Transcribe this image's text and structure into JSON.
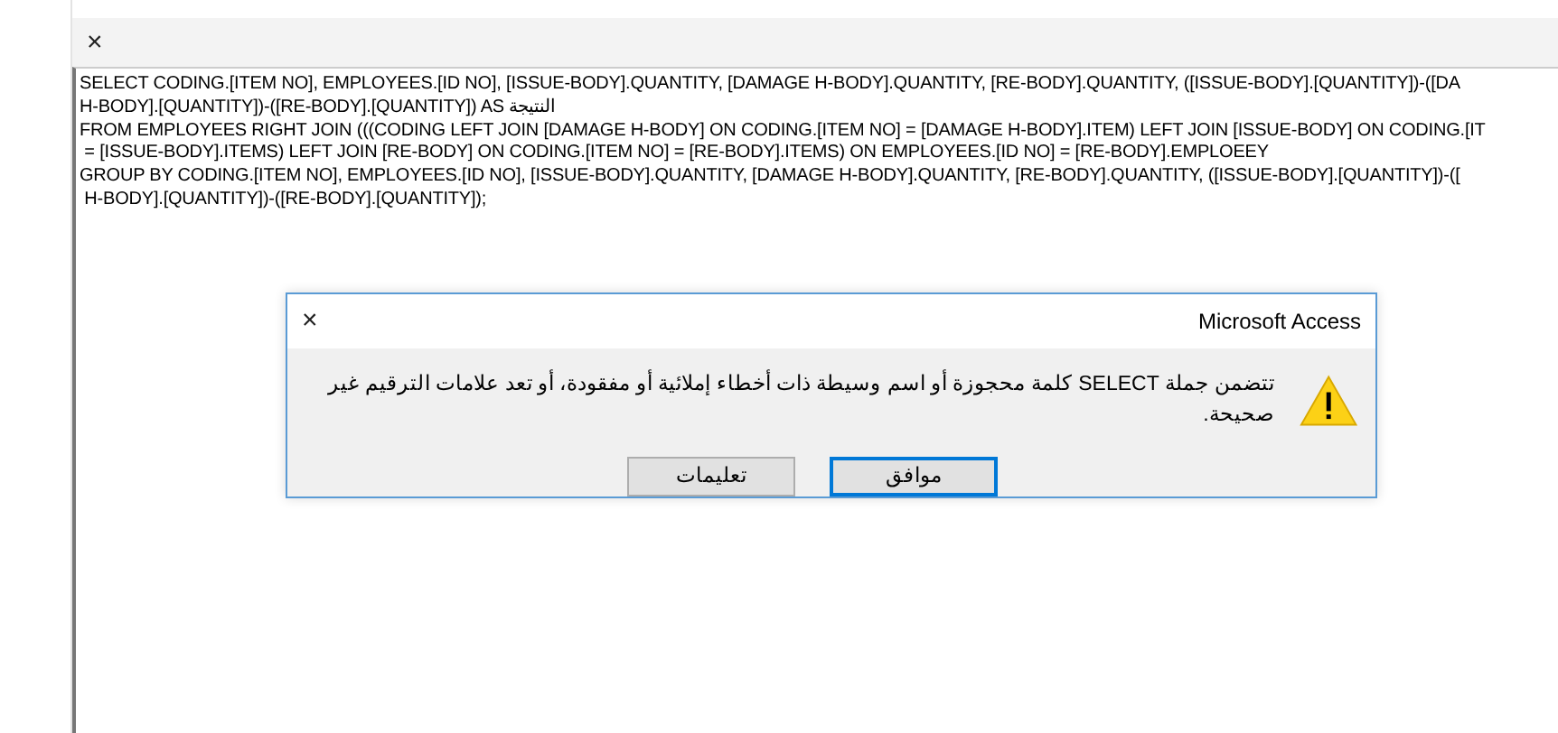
{
  "editor": {
    "close": "×",
    "sql_lines": [
      "SELECT CODING.[ITEM NO], EMPLOYEES.[ID NO], [ISSUE-BODY].QUANTITY, [DAMAGE H-BODY].QUANTITY, [RE-BODY].QUANTITY, ([ISSUE-BODY].[QUANTITY])-([DA",
      "H-BODY].[QUANTITY])-([RE-BODY].[QUANTITY]) AS النتيجة",
      "FROM EMPLOYEES RIGHT JOIN (((CODING LEFT JOIN [DAMAGE H-BODY] ON CODING.[ITEM NO] = [DAMAGE H-BODY].ITEM) LEFT JOIN [ISSUE-BODY] ON CODING.[IT",
      " = [ISSUE-BODY].ITEMS) LEFT JOIN [RE-BODY] ON CODING.[ITEM NO] = [RE-BODY].ITEMS) ON EMPLOYEES.[ID NO] = [RE-BODY].EMPLOEEY",
      "GROUP BY CODING.[ITEM NO], EMPLOYEES.[ID NO], [ISSUE-BODY].QUANTITY, [DAMAGE H-BODY].QUANTITY, [RE-BODY].QUANTITY, ([ISSUE-BODY].[QUANTITY])-([",
      " H-BODY].[QUANTITY])-([RE-BODY].[QUANTITY]);"
    ]
  },
  "dialog": {
    "title": "Microsoft Access",
    "close": "×",
    "message": "تتضمن جملة SELECT كلمة محجوزة أو اسم وسيطة ذات أخطاء إملائية أو مفقودة، أو تعد علامات الترقيم غير صحيحة.",
    "buttons": [
      {
        "label": "موافق",
        "default": true
      },
      {
        "label": "تعليمات",
        "default": false
      }
    ]
  }
}
